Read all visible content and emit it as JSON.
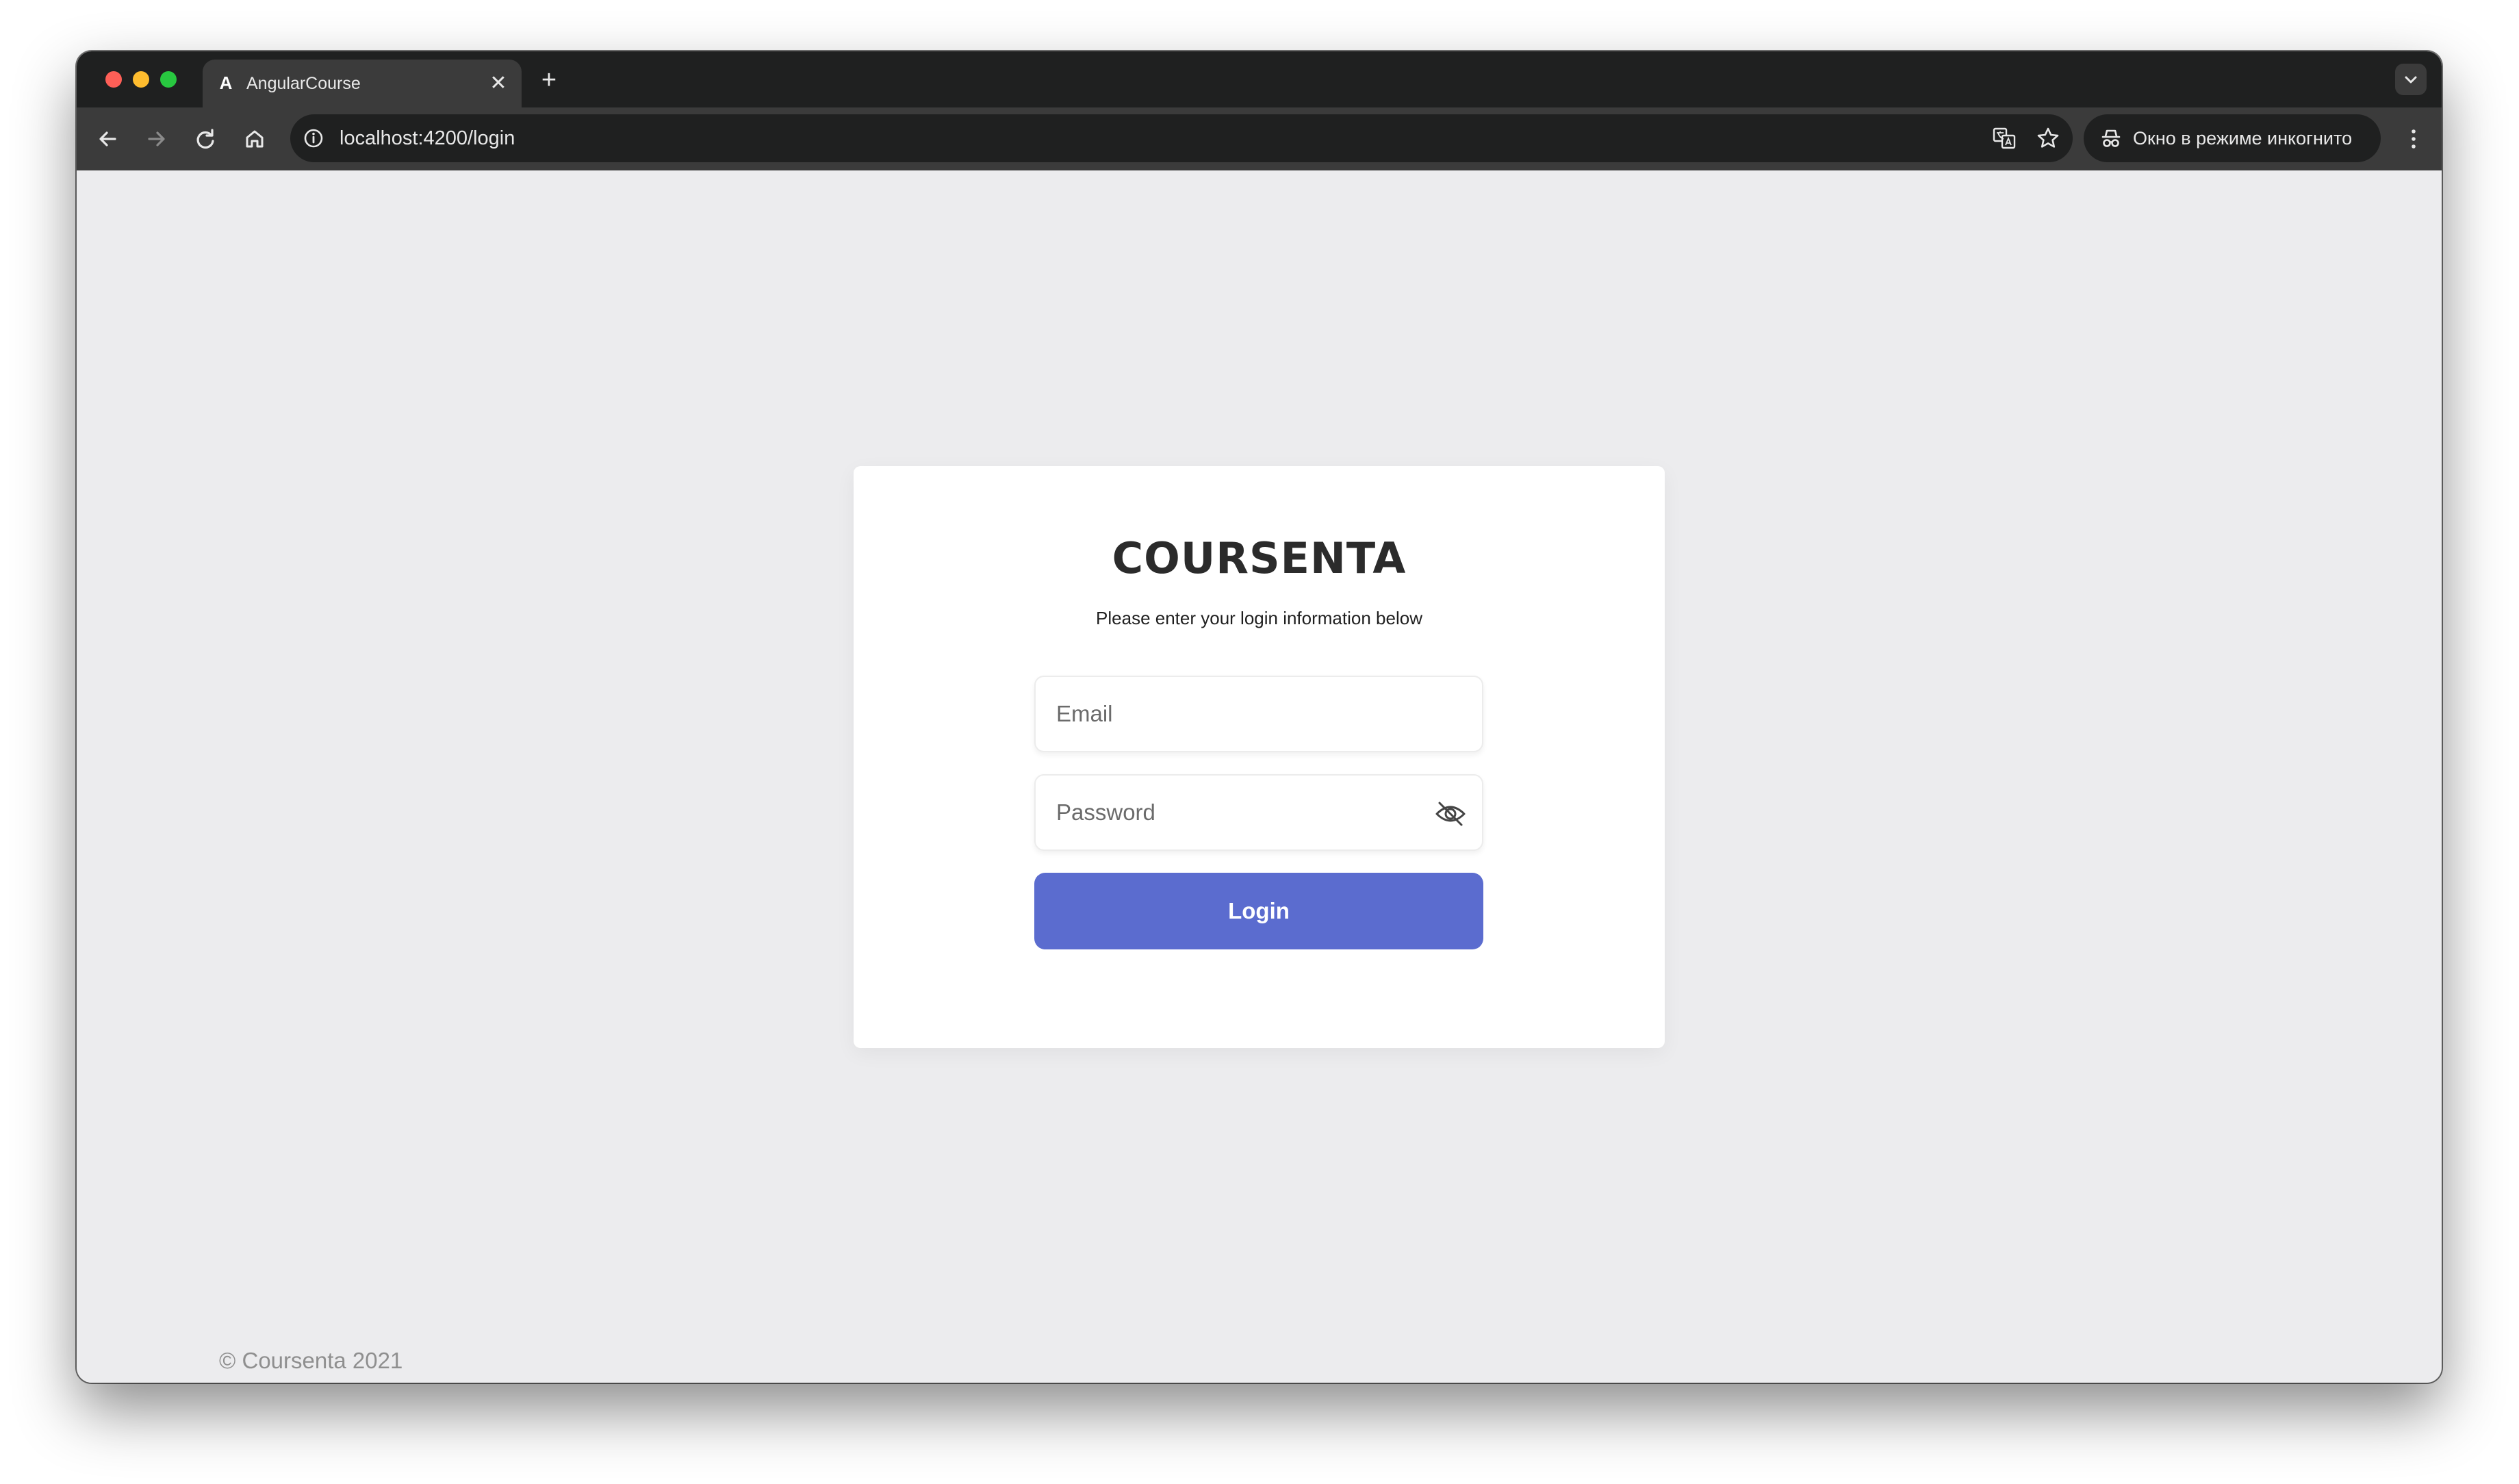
{
  "browser": {
    "tab_title": "AngularCourse",
    "tab_favicon": "A",
    "tab_close": "✕",
    "new_tab": "+",
    "url": "localhost:4200/login",
    "incognito_label": "Окно в режиме инкогнито"
  },
  "login": {
    "brand": "COURSENTA",
    "subtitle": "Please enter your login information below",
    "email_placeholder": "Email",
    "password_placeholder": "Password",
    "login_button": "Login"
  },
  "footer": {
    "copyright": "© Coursenta 2021"
  },
  "colors": {
    "accent": "#5b6ccf",
    "page_background": "#ececee",
    "browser_frame": "#1f2020",
    "toolbar": "#3b3b3b"
  },
  "icons": {
    "back": "arrow-left-icon",
    "forward": "arrow-right-icon",
    "reload": "reload-icon",
    "home": "home-icon",
    "site_info": "info-icon",
    "translate": "translate-icon",
    "bookmark": "star-icon",
    "incognito": "incognito-icon",
    "menu": "kebab-menu-icon",
    "password_toggle": "eye-off-icon",
    "tab_search": "chevron-down-icon"
  }
}
